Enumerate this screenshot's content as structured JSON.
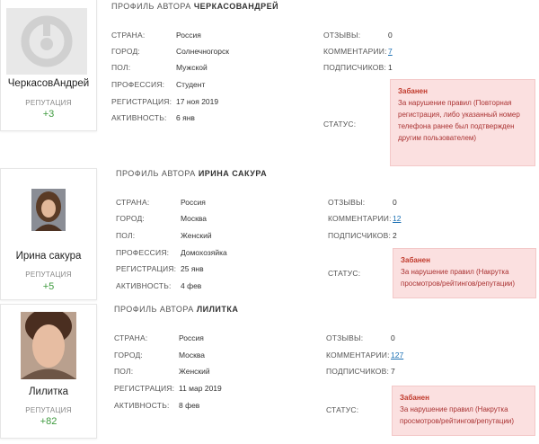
{
  "profiles": [
    {
      "title_prefix": "ПРОФИЛЬ АВТОРА",
      "author": "ЧЕРКАСОВАНДРЕЙ",
      "username": "ЧеркасовАндрей",
      "reputation_label": "РЕПУТАЦИЯ",
      "reputation": "+3",
      "avatar": "default-avatar-icon",
      "left": [
        {
          "label": "СТРАНА:",
          "value": "Россия"
        },
        {
          "label": "ГОРОД:",
          "value": "Солнечногорск"
        },
        {
          "label": "ПОЛ:",
          "value": "Мужской"
        },
        {
          "label": "ПРОФЕССИЯ:",
          "value": "Студент"
        },
        {
          "label": "РЕГИСТРАЦИЯ:",
          "value": "17 ноя 2019"
        },
        {
          "label": "АКТИВНОСТЬ:",
          "value": "6 янв"
        }
      ],
      "right": [
        {
          "label": "ОТЗЫВЫ:",
          "value": "0"
        },
        {
          "label": "КОММЕНТАРИИ:",
          "value": "7"
        },
        {
          "label": "ПОДПИСЧИКОВ:",
          "value": "1"
        }
      ],
      "status_label": "СТАТУС:",
      "ban_title": "Забанен",
      "ban_text": "За нарушение правил (Повторная регистрация, либо указанный номер телефона ранее был подтвержден другим пользователем)"
    },
    {
      "title_prefix": "ПРОФИЛЬ АВТОРА",
      "author": "ИРИНА САКУРА",
      "username": "Ирина сакура",
      "reputation_label": "РЕПУТАЦИЯ",
      "reputation": "+5",
      "avatar": "user-photo",
      "left": [
        {
          "label": "СТРАНА:",
          "value": "Россия"
        },
        {
          "label": "ГОРОД:",
          "value": "Москва"
        },
        {
          "label": "ПОЛ:",
          "value": "Женский"
        },
        {
          "label": "ПРОФЕССИЯ:",
          "value": "Домохозяйка"
        },
        {
          "label": "РЕГИСТРАЦИЯ:",
          "value": "25 янв"
        },
        {
          "label": "АКТИВНОСТЬ:",
          "value": "4 фев"
        }
      ],
      "right": [
        {
          "label": "ОТЗЫВЫ:",
          "value": "0"
        },
        {
          "label": "КОММЕНТАРИИ:",
          "value": "12"
        },
        {
          "label": "ПОДПИСЧИКОВ:",
          "value": "2"
        }
      ],
      "status_label": "СТАТУС:",
      "ban_title": "Забанен",
      "ban_text": "За нарушение правил (Накрутка просмотров/рейтингов/репутации)"
    },
    {
      "title_prefix": "ПРОФИЛЬ АВТОРА",
      "author": "ЛИЛИТКА",
      "username": "Лилитка",
      "reputation_label": "РЕПУТАЦИЯ",
      "reputation": "+82",
      "avatar": "user-photo",
      "left": [
        {
          "label": "СТРАНА:",
          "value": "Россия"
        },
        {
          "label": "ГОРОД:",
          "value": "Москва"
        },
        {
          "label": "ПОЛ:",
          "value": "Женский"
        },
        {
          "label": "РЕГИСТРАЦИЯ:",
          "value": "11 мар 2019"
        },
        {
          "label": "АКТИВНОСТЬ:",
          "value": "8 фев"
        }
      ],
      "right": [
        {
          "label": "ОТЗЫВЫ:",
          "value": "0"
        },
        {
          "label": "КОММЕНТАРИИ:",
          "value": "127"
        },
        {
          "label": "ПОДПИСЧИКОВ:",
          "value": "7"
        }
      ],
      "status_label": "СТАТУС:",
      "ban_title": "Забанен",
      "ban_text": "За нарушение правил (Накрутка просмотров/рейтингов/репутации)"
    }
  ],
  "colors": {
    "link": "#1a6fb3",
    "reputation": "#3e9a3e",
    "ban_bg": "#fbe0e0",
    "ban_text": "#a33333"
  }
}
